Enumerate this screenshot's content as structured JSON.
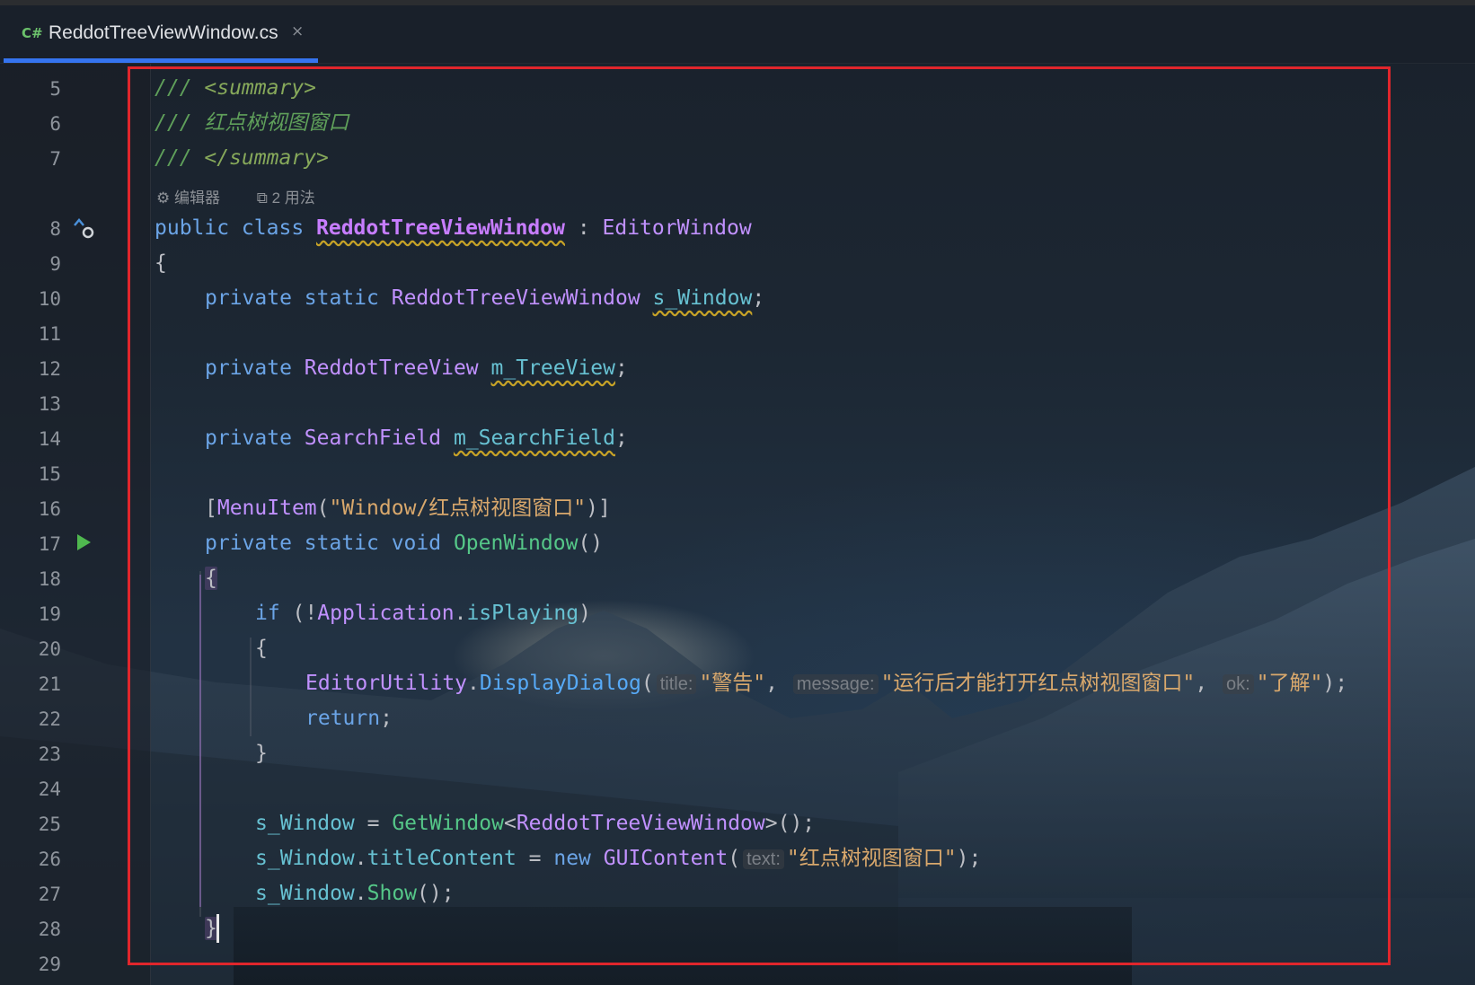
{
  "tab": {
    "lang_label": "C#",
    "file_name": "ReddotTreeViewWindow.cs",
    "close_glyph": "×"
  },
  "gutter": {
    "line_numbers": [
      "5",
      "6",
      "7",
      "8",
      "9",
      "10",
      "11",
      "12",
      "13",
      "14",
      "15",
      "16",
      "17",
      "18",
      "19",
      "20",
      "21",
      "22",
      "23",
      "24",
      "25",
      "26",
      "27",
      "28",
      "29"
    ]
  },
  "codelens": {
    "editor_label": "编辑器",
    "usages_label": "2 用法"
  },
  "code": {
    "l5": {
      "a": "/// ",
      "b": "<summary>"
    },
    "l6": {
      "a": "/// 红点树视图窗口"
    },
    "l7": {
      "a": "/// ",
      "b": "</summary>"
    },
    "l8": {
      "kw": "public class ",
      "cls": "ReddotTreeViewWindow",
      "sep": " : ",
      "base": "EditorWindow"
    },
    "l9": {
      "a": "{"
    },
    "l10": {
      "kw": "private static ",
      "type": "ReddotTreeViewWindow",
      "sp": " ",
      "fld": "s_Window",
      "end": ";"
    },
    "l12": {
      "kw": "private ",
      "type": "ReddotTreeView",
      "sp": " ",
      "fld": "m_TreeView",
      "end": ";"
    },
    "l14": {
      "kw": "private ",
      "type": "SearchField",
      "sp": " ",
      "fld": "m_SearchField",
      "end": ";"
    },
    "l16": {
      "open": "[",
      "attr": "MenuItem",
      "paren": "(",
      "str": "\"Window/红点树视图窗口\"",
      "close": ")]"
    },
    "l17": {
      "kw": "private static void ",
      "fn": "OpenWindow",
      "end": "()"
    },
    "l18": {
      "a": "{"
    },
    "l19": {
      "kw": "if",
      "a": " (!",
      "cls": "Application",
      "dot": ".",
      "fld": "isPlaying",
      "end": ")"
    },
    "l20": {
      "a": "{"
    },
    "l21": {
      "cls": "EditorUtility",
      "dot": ".",
      "fn": "DisplayDialog",
      "paren": "(",
      "h1": "title:",
      "s1": "\"警告\"",
      "c1": ", ",
      "h2": "message:",
      "s2": "\"运行后才能打开红点树视图窗口\"",
      "c2": ", ",
      "h3": "ok:",
      "s3": "\"了解\"",
      "end": ");"
    },
    "l22": {
      "kw": "return",
      "end": ";"
    },
    "l23": {
      "a": "}"
    },
    "l25": {
      "fld": "s_Window",
      "eq": " = ",
      "fn": "GetWindow",
      "lt": "<",
      "cls": "ReddotTreeViewWindow",
      "end": ">();"
    },
    "l26": {
      "fld": "s_Window",
      "dot": ".",
      "fld2": "titleContent",
      "eq": " = ",
      "kw": "new ",
      "cls": "GUIContent",
      "paren": "(",
      "h1": "text:",
      "s1": "\"红点树视图窗口\"",
      "end": ");"
    },
    "l27": {
      "fld": "s_Window",
      "dot": ".",
      "fn": "Show",
      "end": "();"
    },
    "l28": {
      "a": "}"
    }
  },
  "colors": {
    "accent_tab": "#3574f0",
    "highlight_box": "#e0262c",
    "run_gutter": "#4fb84f"
  }
}
